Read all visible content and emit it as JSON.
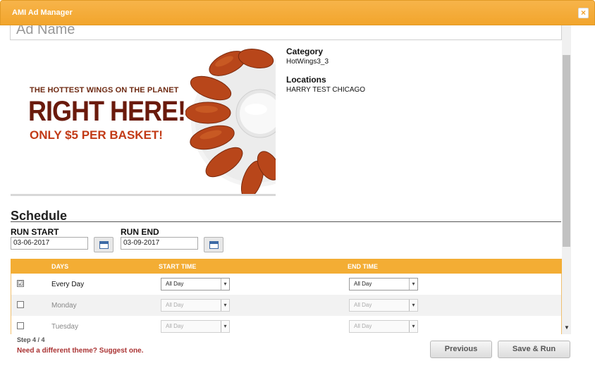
{
  "window": {
    "title": "AMI Ad Manager",
    "close_label": "×"
  },
  "ad": {
    "name_partial": "Ad Name",
    "banner_line1": "THE HOTTEST WINGS ON THE PLANET",
    "banner_line2": "RIGHT HERE!",
    "banner_line3": "ONLY $5 PER BASKET!"
  },
  "details": {
    "category_label": "Category",
    "category_value": "HotWings3_3",
    "locations_label": "Locations",
    "locations_value": "HARRY TEST CHICAGO"
  },
  "schedule": {
    "title": "Schedule",
    "run_start_label": "RUN START",
    "run_start_value": "03-06-2017",
    "run_end_label": "RUN END",
    "run_end_value": "03-09-2017",
    "columns": [
      "DAYS",
      "START TIME",
      "END TIME"
    ],
    "rows": [
      {
        "checked": "☑",
        "day": "Every Day",
        "start": "All Day",
        "end": "All Day"
      },
      {
        "checked": "",
        "day": "Monday",
        "start": "All Day",
        "end": "All Day"
      },
      {
        "checked": "",
        "day": "Tuesday",
        "start": "All Day",
        "end": "All Day"
      }
    ]
  },
  "footer": {
    "step": "Step 4 / 4",
    "suggest_link": "Need a different theme? Suggest one.",
    "previous_label": "Previous",
    "save_run_label": "Save & Run"
  },
  "icons": {
    "dropdown": "▾",
    "scroll_up": "▲",
    "scroll_down": "▼"
  }
}
